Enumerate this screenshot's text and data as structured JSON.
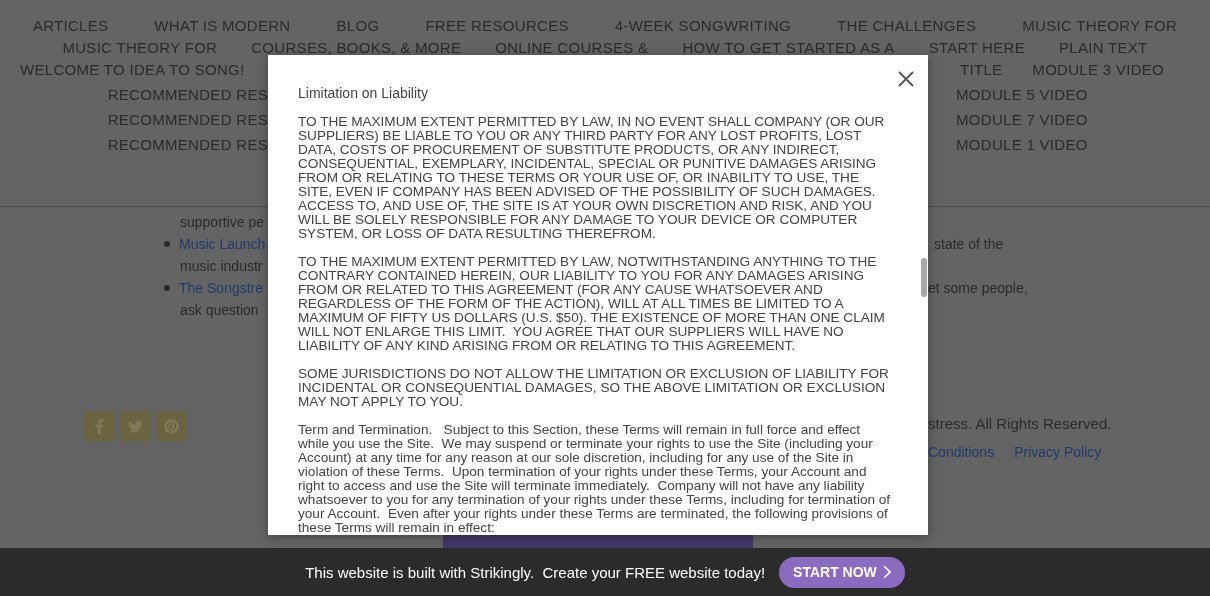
{
  "nav": {
    "full_rows": [
      [
        "ARTICLES",
        "WHAT IS MODERN",
        "BLOG",
        "FREE RESOURCES",
        "4-WEEK SONGWRITING",
        "THE CHALLENGES",
        "MUSIC THEORY FOR"
      ],
      [
        "MUSIC THEORY FOR",
        "COURSES, BOOKS, & MORE",
        "ONLINE COURSES &",
        "HOW TO GET STARTED AS A",
        "START HERE",
        "PLAIN TEXT"
      ]
    ],
    "split_rows": [
      {
        "left": "WELCOME TO IDEA TO SONG!",
        "right": [
          "TITLE",
          "MODULE 3 VIDEO"
        ]
      },
      {
        "left": "RECOMMENDED RES",
        "right": [
          "MODULE 5 VIDEO"
        ]
      },
      {
        "left": "RECOMMENDED RES",
        "right": [
          "MODULE 7 VIDEO"
        ]
      },
      {
        "left": "RECOMMENDED RES",
        "right": [
          "MODULE 1 VIDEO"
        ]
      }
    ]
  },
  "content": {
    "lines": [
      {
        "kind": "text",
        "left": "supportive pe"
      },
      {
        "kind": "bullet_link",
        "left": "Music Launch",
        "right": "state of the"
      },
      {
        "kind": "text",
        "left": "music industr"
      },
      {
        "kind": "bullet_link",
        "left": "The Songstre",
        "right": "et some people,"
      },
      {
        "kind": "text",
        "left": "ask question"
      }
    ]
  },
  "footer": {
    "social": [
      {
        "kind": "facebook"
      },
      {
        "kind": "twitter"
      },
      {
        "kind": "pinterest"
      }
    ],
    "copyright": "stress. All Rights Reserved.",
    "links": [
      "Conditions",
      "Privacy Policy"
    ]
  },
  "modal": {
    "heading": "Limitation on Liability",
    "paragraphs": [
      "TO THE MAXIMUM EXTENT PERMITTED BY LAW, IN NO EVENT SHALL COMPANY (OR OUR SUPPLIERS) BE LIABLE TO YOU OR ANY THIRD PARTY FOR ANY LOST PROFITS, LOST DATA, COSTS OF PROCUREMENT OF SUBSTITUTE PRODUCTS, OR ANY INDIRECT, CONSEQUENTIAL, EXEMPLARY, INCIDENTAL, SPECIAL OR PUNITIVE DAMAGES ARISING FROM OR RELATING TO THESE TERMS OR YOUR USE OF, OR INABILITY TO USE, THE SITE, EVEN IF COMPANY HAS BEEN ADVISED OF THE POSSIBILITY OF SUCH DAMAGES.  ACCESS TO, AND USE OF, THE SITE IS AT YOUR OWN DISCRETION AND RISK, AND YOU WILL BE SOLELY RESPONSIBLE FOR ANY DAMAGE TO YOUR DEVICE OR COMPUTER SYSTEM, OR LOSS OF DATA RESULTING THEREFROM.",
      "TO THE MAXIMUM EXTENT PERMITTED BY LAW, NOTWITHSTANDING ANYTHING TO THE CONTRARY CONTAINED HEREIN, OUR LIABILITY TO YOU FOR ANY DAMAGES ARISING FROM OR RELATED TO THIS AGREEMENT (FOR ANY CAUSE WHATSOEVER AND REGARDLESS OF THE FORM OF THE ACTION), WILL AT ALL TIMES BE LIMITED TO A MAXIMUM OF FIFTY US DOLLARS (U.S. $50). THE EXISTENCE OF MORE THAN ONE CLAIM WILL NOT ENLARGE THIS LIMIT.  YOU AGREE THAT OUR SUPPLIERS WILL HAVE NO LIABILITY OF ANY KIND ARISING FROM OR RELATING TO THIS AGREEMENT.",
      "SOME JURISDICTIONS DO NOT ALLOW THE LIMITATION OR EXCLUSION OF LIABILITY FOR INCIDENTAL OR CONSEQUENTIAL DAMAGES, SO THE ABOVE LIMITATION OR EXCLUSION MAY NOT APPLY TO YOU.",
      "Term and Termination.   Subject to this Section, these Terms will remain in full force and effect while you use the Site.  We may suspend or terminate your rights to use the Site (including your Account) at any time for any reason at our sole discretion, including for any use of the Site in violation of these Terms.  Upon termination of your rights under these Terms, your Account and right to access and use the Site will terminate immediately.  Company will not have any liability whatsoever to you for any termination of your rights under these Terms, including for termination of your Account.  Even after your rights under these Terms are terminated, the following provisions of these Terms will remain in effect:"
    ]
  },
  "banner": {
    "text": "This website is built with Strikingly.  Create your FREE website today!",
    "button": "START NOW"
  }
}
